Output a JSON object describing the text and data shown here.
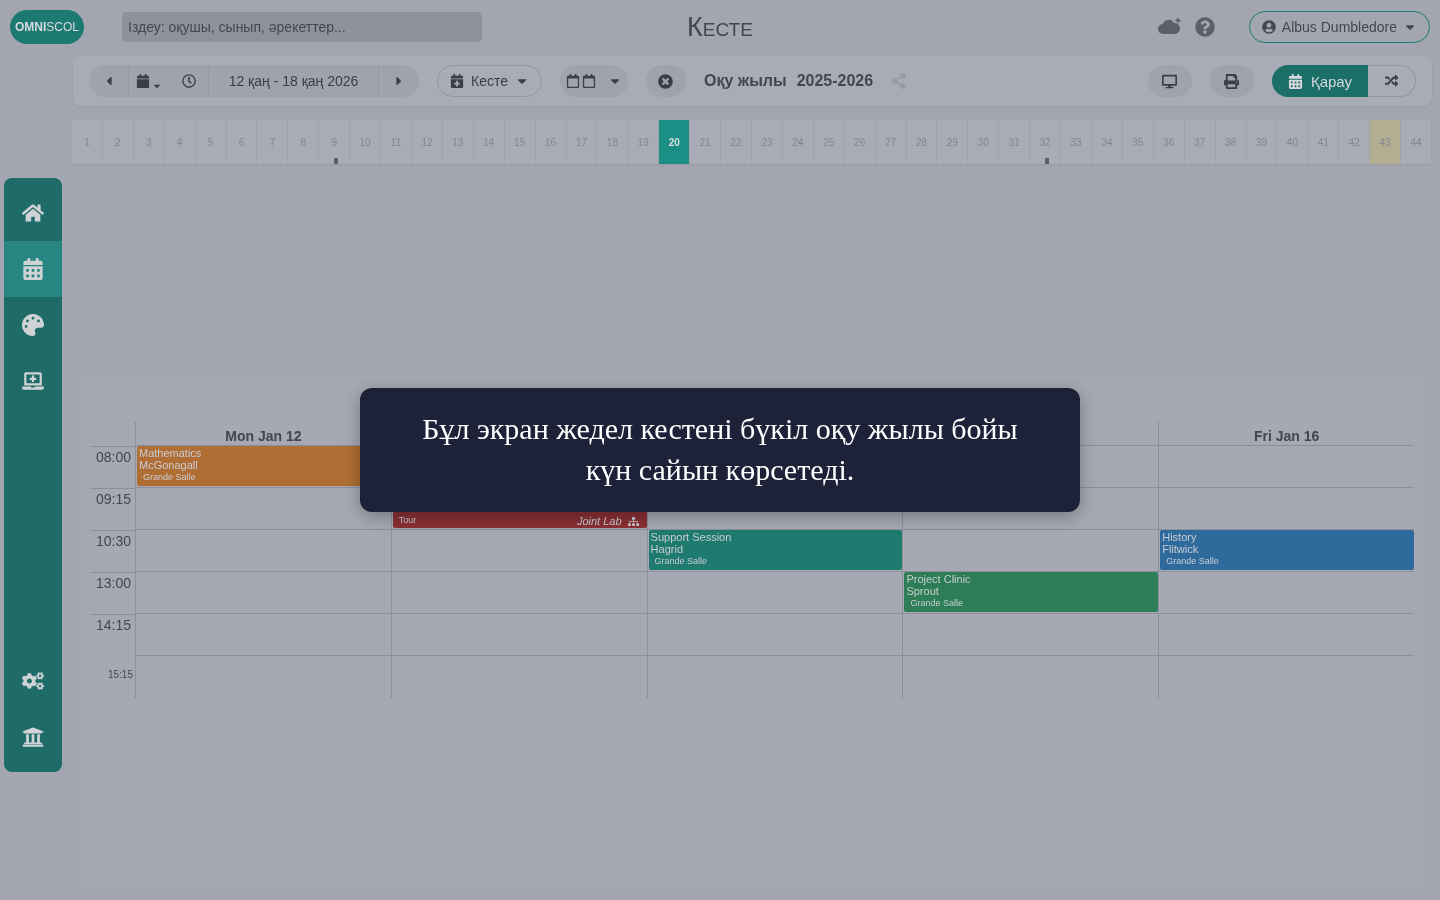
{
  "header": {
    "logo": {
      "bold": "OMNI",
      "light": "SCOL"
    },
    "search": {
      "placeholder": "Іздеу: оқушы, сынып, әрекеттер..."
    },
    "title": "Кесте",
    "user": "Albus Dumbledore"
  },
  "toolbar": {
    "date_range": "12 қаң - 18 қаң 2026",
    "view_menu": "Кесте",
    "year_label": "Оқу жылы",
    "year_value": "2025-2026",
    "primary_button": "Қарау"
  },
  "weeks": [
    {
      "label": "1",
      "selected": false,
      "highlighted": false,
      "marked": false
    },
    {
      "label": "2",
      "selected": false,
      "highlighted": false,
      "marked": false
    },
    {
      "label": "3",
      "selected": false,
      "highlighted": false,
      "marked": false
    },
    {
      "label": "4",
      "selected": false,
      "highlighted": false,
      "marked": false
    },
    {
      "label": "5",
      "selected": false,
      "highlighted": false,
      "marked": false
    },
    {
      "label": "6",
      "selected": false,
      "highlighted": false,
      "marked": false
    },
    {
      "label": "7",
      "selected": false,
      "highlighted": false,
      "marked": false
    },
    {
      "label": "8",
      "selected": false,
      "highlighted": false,
      "marked": false
    },
    {
      "label": "9",
      "selected": false,
      "highlighted": false,
      "marked": true
    },
    {
      "label": "10",
      "selected": false,
      "highlighted": false,
      "marked": false
    },
    {
      "label": "11",
      "selected": false,
      "highlighted": false,
      "marked": false
    },
    {
      "label": "12",
      "selected": false,
      "highlighted": false,
      "marked": false
    },
    {
      "label": "13",
      "selected": false,
      "highlighted": false,
      "marked": false
    },
    {
      "label": "14",
      "selected": false,
      "highlighted": false,
      "marked": false
    },
    {
      "label": "15",
      "selected": false,
      "highlighted": false,
      "marked": false
    },
    {
      "label": "16",
      "selected": false,
      "highlighted": false,
      "marked": false
    },
    {
      "label": "17",
      "selected": false,
      "highlighted": false,
      "marked": false
    },
    {
      "label": "18",
      "selected": false,
      "highlighted": false,
      "marked": false
    },
    {
      "label": "19",
      "selected": false,
      "highlighted": false,
      "marked": false
    },
    {
      "label": "20",
      "selected": true,
      "highlighted": false,
      "marked": false
    },
    {
      "label": "21",
      "selected": false,
      "highlighted": false,
      "marked": false
    },
    {
      "label": "22",
      "selected": false,
      "highlighted": false,
      "marked": false
    },
    {
      "label": "23",
      "selected": false,
      "highlighted": false,
      "marked": false
    },
    {
      "label": "24",
      "selected": false,
      "highlighted": false,
      "marked": false
    },
    {
      "label": "25",
      "selected": false,
      "highlighted": false,
      "marked": false
    },
    {
      "label": "26",
      "selected": false,
      "highlighted": false,
      "marked": false
    },
    {
      "label": "27",
      "selected": false,
      "highlighted": false,
      "marked": false
    },
    {
      "label": "28",
      "selected": false,
      "highlighted": false,
      "marked": false
    },
    {
      "label": "29",
      "selected": false,
      "highlighted": false,
      "marked": false
    },
    {
      "label": "30",
      "selected": false,
      "highlighted": false,
      "marked": false
    },
    {
      "label": "31",
      "selected": false,
      "highlighted": false,
      "marked": false
    },
    {
      "label": "32",
      "selected": false,
      "highlighted": false,
      "marked": true
    },
    {
      "label": "33",
      "selected": false,
      "highlighted": false,
      "marked": false
    },
    {
      "label": "34",
      "selected": false,
      "highlighted": false,
      "marked": false
    },
    {
      "label": "35",
      "selected": false,
      "highlighted": false,
      "marked": false
    },
    {
      "label": "36",
      "selected": false,
      "highlighted": false,
      "marked": false
    },
    {
      "label": "37",
      "selected": false,
      "highlighted": false,
      "marked": false
    },
    {
      "label": "38",
      "selected": false,
      "highlighted": false,
      "marked": false
    },
    {
      "label": "39",
      "selected": false,
      "highlighted": false,
      "marked": false
    },
    {
      "label": "40",
      "selected": false,
      "highlighted": false,
      "marked": false
    },
    {
      "label": "41",
      "selected": false,
      "highlighted": false,
      "marked": false
    },
    {
      "label": "42",
      "selected": false,
      "highlighted": false,
      "marked": false
    },
    {
      "label": "43",
      "selected": false,
      "highlighted": true,
      "marked": false
    },
    {
      "label": "44",
      "selected": false,
      "highlighted": false,
      "marked": false
    }
  ],
  "sidebar": {
    "items": [
      {
        "kind": "home",
        "selected": false
      },
      {
        "kind": "calendar",
        "selected": true
      },
      {
        "kind": "palette",
        "selected": false
      },
      {
        "kind": "laptop",
        "selected": false
      }
    ],
    "bottom_items": [
      {
        "kind": "cogs"
      },
      {
        "kind": "bank"
      }
    ]
  },
  "calendar": {
    "times": [
      {
        "label": "08:00"
      },
      {
        "label": "09:15"
      },
      {
        "label": "10:30"
      },
      {
        "label": "13:00"
      },
      {
        "label": "14:15"
      }
    ],
    "end_time": "15:15",
    "days": [
      {
        "label": "Mon Jan 12",
        "slots": [
          {
            "kind": "event",
            "color": "#b06e35",
            "lines": [
              "Mathematics",
              "McGonagall"
            ],
            "room": "Grande Salle"
          },
          {
            "kind": "empty"
          },
          {
            "kind": "empty"
          },
          {
            "kind": "empty"
          },
          {
            "kind": "empty"
          }
        ]
      },
      {
        "slots": [
          {
            "kind": "covered"
          },
          {
            "kind": "event",
            "color": "#8a3035",
            "room": "Tour",
            "linked": "Joint Lab"
          },
          {
            "kind": "empty"
          },
          {
            "kind": "empty"
          },
          {
            "kind": "empty"
          }
        ]
      },
      {
        "slots": [
          {
            "kind": "covered"
          },
          {
            "kind": "empty"
          },
          {
            "kind": "event",
            "color": "#1f7a70",
            "lines": [
              "Support Session",
              "Hagrid"
            ],
            "room": "Grande Salle"
          },
          {
            "kind": "empty"
          },
          {
            "kind": "empty"
          }
        ]
      },
      {
        "slots": [
          {
            "kind": "empty"
          },
          {
            "kind": "empty"
          },
          {
            "kind": "empty"
          },
          {
            "kind": "event",
            "color": "#2d7e56",
            "lines": [
              "Project Clinic",
              "Sprout"
            ],
            "room": "Grande Salle"
          },
          {
            "kind": "empty"
          }
        ]
      },
      {
        "label": "Fri Jan 16",
        "slots": [
          {
            "kind": "empty"
          },
          {
            "kind": "empty"
          },
          {
            "kind": "event",
            "color": "#2e6b9c",
            "lines": [
              "History",
              "Flitwick"
            ],
            "room": "Grande Salle"
          },
          {
            "kind": "empty"
          },
          {
            "kind": "empty"
          }
        ]
      }
    ]
  },
  "tooltip": "Бұл экран жедел кестені бүкіл оқу жылы бойы күн сайын көрсетеді."
}
